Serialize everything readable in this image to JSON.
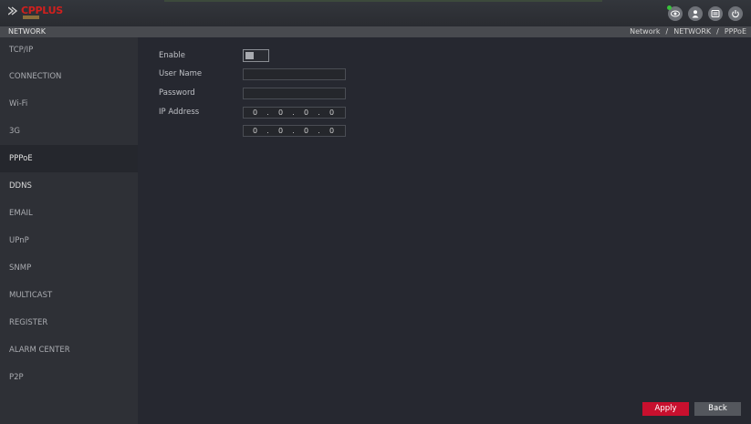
{
  "brand": {
    "logo_text": "CPPLUS"
  },
  "header": {
    "title": "NETWORK",
    "breadcrumb": [
      "Network",
      "/",
      "NETWORK",
      "/",
      "PPPoE"
    ]
  },
  "top_icons": [
    "eye-icon",
    "user-icon",
    "menu-icon",
    "power-icon"
  ],
  "sidebar": {
    "items": [
      {
        "label": "TCP/IP"
      },
      {
        "label": "CONNECTION"
      },
      {
        "label": "Wi-Fi"
      },
      {
        "label": "3G"
      },
      {
        "label": "PPPoE"
      },
      {
        "label": "DDNS"
      },
      {
        "label": "EMAIL"
      },
      {
        "label": "UPnP"
      },
      {
        "label": "SNMP"
      },
      {
        "label": "MULTICAST"
      },
      {
        "label": "REGISTER"
      },
      {
        "label": "ALARM CENTER"
      },
      {
        "label": "P2P"
      }
    ],
    "active": "PPPoE"
  },
  "form": {
    "enable_label": "Enable",
    "enable_on": false,
    "username_label": "User Name",
    "username_value": "",
    "password_label": "Password",
    "password_value": "",
    "ip_label": "IP Address",
    "ip1": [
      "0",
      "0",
      "0",
      "0"
    ],
    "ip2": [
      "0",
      "0",
      "0",
      "0"
    ]
  },
  "buttons": {
    "apply": "Apply",
    "back": "Back"
  },
  "colors": {
    "accent": "#c8102e",
    "background": "#262830",
    "sidebar": "#2e3036"
  }
}
